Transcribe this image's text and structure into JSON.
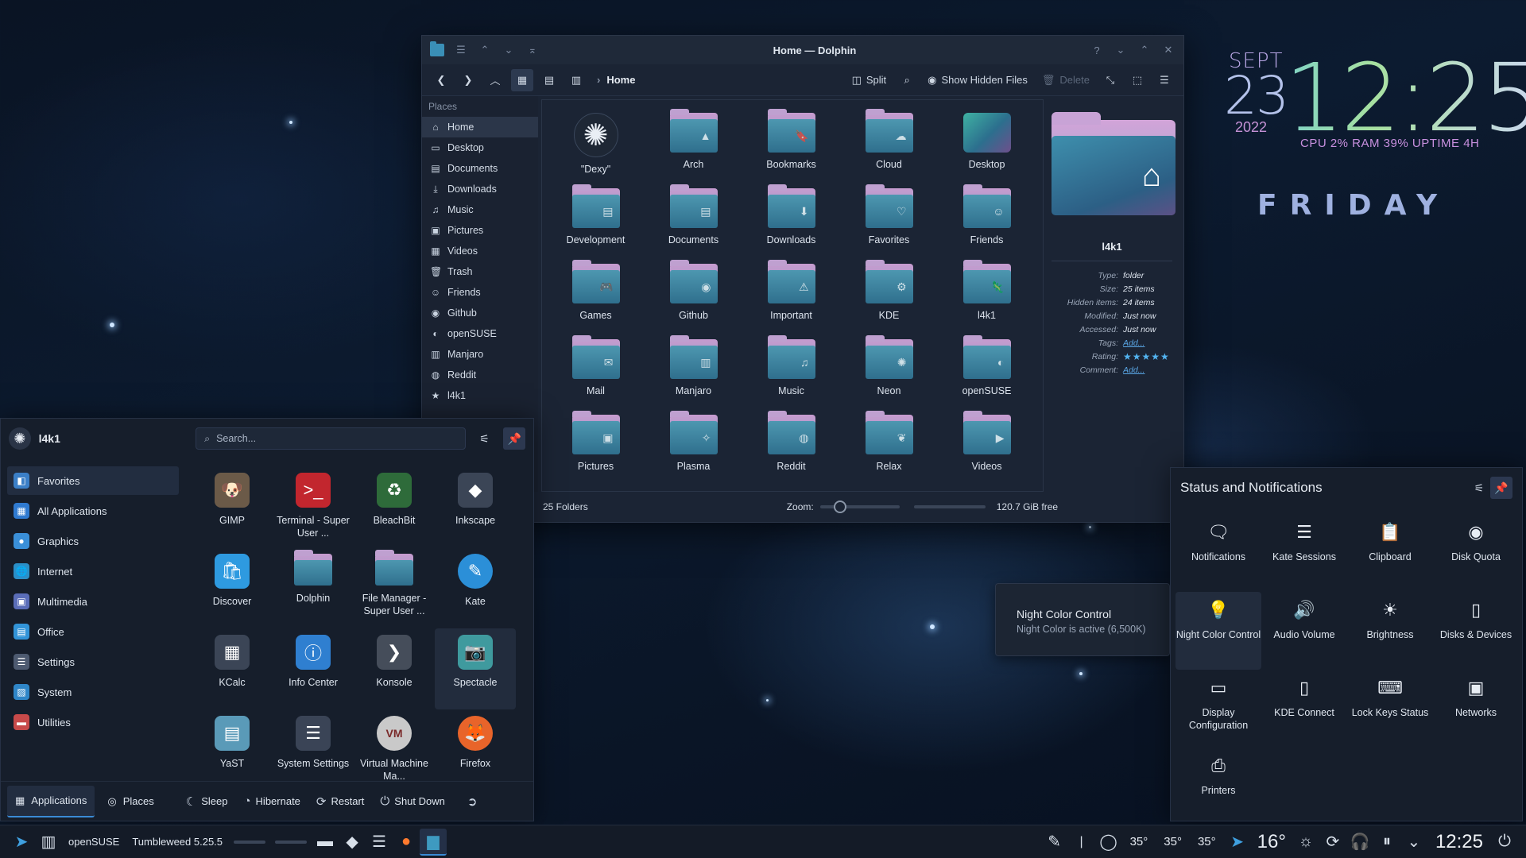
{
  "clock": {
    "month": "SEPT",
    "day": "23",
    "year": "2022",
    "time": "12:25",
    "stats": "CPU 2% RAM 39% UPTIME 4H",
    "weekday": "FRIDAY"
  },
  "dolphin": {
    "title": "Home — Dolphin",
    "breadcrumb": "Home",
    "toolbar": {
      "split": "Split",
      "show_hidden": "Show Hidden Files",
      "delete": "Delete"
    },
    "places_header": "Places",
    "places": [
      {
        "label": "Home",
        "icon": "home-icon",
        "glyph": "⌂",
        "selected": true
      },
      {
        "label": "Desktop",
        "icon": "desktop-icon",
        "glyph": "▭"
      },
      {
        "label": "Documents",
        "icon": "document-icon",
        "glyph": "▤"
      },
      {
        "label": "Downloads",
        "icon": "download-icon",
        "glyph": "⤓"
      },
      {
        "label": "Music",
        "icon": "music-icon",
        "glyph": "♫"
      },
      {
        "label": "Pictures",
        "icon": "picture-icon",
        "glyph": "▣"
      },
      {
        "label": "Videos",
        "icon": "video-icon",
        "glyph": "▦"
      },
      {
        "label": "Trash",
        "icon": "trash-icon",
        "glyph": "🗑"
      },
      {
        "label": "Friends",
        "icon": "friends-icon",
        "glyph": "☺"
      },
      {
        "label": "Github",
        "icon": "github-icon",
        "glyph": "◉"
      },
      {
        "label": "openSUSE",
        "icon": "opensuse-icon",
        "glyph": "◐"
      },
      {
        "label": "Manjaro",
        "icon": "manjaro-icon",
        "glyph": "▥"
      },
      {
        "label": "Reddit",
        "icon": "reddit-icon",
        "glyph": "◍"
      },
      {
        "label": "l4k1",
        "icon": "star-icon",
        "glyph": "★"
      }
    ],
    "folders": [
      {
        "label": "\"Dexy\"",
        "kind": "dexy",
        "glyph": "✺"
      },
      {
        "label": "Arch",
        "glyph": "▲"
      },
      {
        "label": "Bookmarks",
        "glyph": "🔖"
      },
      {
        "label": "Cloud",
        "glyph": "☁"
      },
      {
        "label": "Desktop",
        "kind": "desktop"
      },
      {
        "label": "Development",
        "glyph": "▤"
      },
      {
        "label": "Documents",
        "glyph": "▤"
      },
      {
        "label": "Downloads",
        "glyph": "⬇"
      },
      {
        "label": "Favorites",
        "glyph": "♡"
      },
      {
        "label": "Friends",
        "glyph": "☺"
      },
      {
        "label": "Games",
        "glyph": "🎮"
      },
      {
        "label": "Github",
        "glyph": "◉"
      },
      {
        "label": "Important",
        "glyph": "⚠"
      },
      {
        "label": "KDE",
        "glyph": "⚙"
      },
      {
        "label": "l4k1",
        "glyph": "🦎"
      },
      {
        "label": "Mail",
        "glyph": "✉"
      },
      {
        "label": "Manjaro",
        "glyph": "▥"
      },
      {
        "label": "Music",
        "glyph": "♫"
      },
      {
        "label": "Neon",
        "glyph": "✺"
      },
      {
        "label": "openSUSE",
        "glyph": "◐"
      },
      {
        "label": "Pictures",
        "glyph": "▣"
      },
      {
        "label": "Plasma",
        "glyph": "✧"
      },
      {
        "label": "Reddit",
        "glyph": "◍"
      },
      {
        "label": "Relax",
        "glyph": "❦"
      },
      {
        "label": "Videos",
        "glyph": "▶"
      }
    ],
    "info": {
      "name": "l4k1",
      "rows": [
        {
          "k": "Type:",
          "v": "folder"
        },
        {
          "k": "Size:",
          "v": "25 items"
        },
        {
          "k": "Hidden items:",
          "v": "24 items"
        },
        {
          "k": "Modified:",
          "v": "Just now"
        },
        {
          "k": "Accessed:",
          "v": "Just now"
        },
        {
          "k": "Tags:",
          "v": "Add...",
          "link": true
        },
        {
          "k": "Rating:",
          "v": "★★★★★",
          "stars": true
        },
        {
          "k": "Comment:",
          "v": "Add...",
          "link": true
        }
      ]
    },
    "status": {
      "count": "25 Folders",
      "zoom_label": "Zoom:",
      "free": "120.7 GiB free",
      "zoom_level": 0.2
    }
  },
  "launcher": {
    "user": "l4k1",
    "search_placeholder": "Search...",
    "categories": [
      {
        "label": "Favorites",
        "icon": "favorites-icon",
        "color": "#3b7fc7",
        "glyph": "◧",
        "selected": true
      },
      {
        "label": "All Applications",
        "icon": "all-apps-icon",
        "color": "#2f7ad0",
        "glyph": "▦"
      },
      {
        "label": "Graphics",
        "icon": "graphics-icon",
        "color": "#3a8fd8",
        "glyph": "●"
      },
      {
        "label": "Internet",
        "icon": "internet-icon",
        "color": "#2a8fc8",
        "glyph": "🌐"
      },
      {
        "label": "Multimedia",
        "icon": "multimedia-icon",
        "color": "#5a6db8",
        "glyph": "▣"
      },
      {
        "label": "Office",
        "icon": "office-icon",
        "color": "#3294d8",
        "glyph": "▤"
      },
      {
        "label": "Settings",
        "icon": "settings-icon",
        "color": "#4d5a70",
        "glyph": "☰"
      },
      {
        "label": "System",
        "icon": "system-icon",
        "color": "#2f86c8",
        "glyph": "▨"
      },
      {
        "label": "Utilities",
        "icon": "utilities-icon",
        "color": "#c74a4a",
        "glyph": "▬"
      }
    ],
    "apps": [
      {
        "label": "GIMP",
        "icon": "gimp-icon",
        "color": "#6b5a48",
        "glyph": "🐶"
      },
      {
        "label": "Terminal - Super User ...",
        "icon": "terminal-icon",
        "color": "#c2262e",
        "glyph": ">_"
      },
      {
        "label": "BleachBit",
        "icon": "bleachbit-icon",
        "color": "#2e6b3a",
        "glyph": "♻"
      },
      {
        "label": "Inkscape",
        "icon": "inkscape-icon",
        "color": "#3b4556",
        "glyph": "◆"
      },
      {
        "label": "Discover",
        "icon": "discover-icon",
        "color": "#2e9ae0",
        "glyph": "🛍"
      },
      {
        "label": "Dolphin",
        "icon": "dolphin-icon",
        "color": "#3e8aab",
        "glyph": ""
      },
      {
        "label": "File Manager - Super User ...",
        "icon": "file-manager-icon",
        "color": "#3e8aab",
        "glyph": ""
      },
      {
        "label": "Kate",
        "icon": "kate-icon",
        "color": "#2b8fd8",
        "glyph": "✎"
      },
      {
        "label": "KCalc",
        "icon": "kcalc-icon",
        "color": "#3b4556",
        "glyph": "▦"
      },
      {
        "label": "Info Center",
        "icon": "info-center-icon",
        "color": "#2f7fd0",
        "glyph": "ⓘ"
      },
      {
        "label": "Konsole",
        "icon": "konsole-icon",
        "color": "#454d5a",
        "glyph": "❯"
      },
      {
        "label": "Spectacle",
        "icon": "spectacle-icon",
        "color": "#3f9a9e",
        "glyph": "📷",
        "hover": true
      },
      {
        "label": "YaST",
        "icon": "yast-icon",
        "color": "#5a9ab8",
        "glyph": "▤"
      },
      {
        "label": "System Settings",
        "icon": "system-settings-icon",
        "color": "#3a4456",
        "glyph": "☰"
      },
      {
        "label": "Virtual Machine Ma...",
        "icon": "virt-manager-icon",
        "color": "#c9c9c9",
        "glyph": "VM"
      },
      {
        "label": "Firefox",
        "icon": "firefox-icon",
        "color": "#e8642a",
        "glyph": "🦊"
      }
    ],
    "footer": {
      "applications": "Applications",
      "places": "Places",
      "sleep": "Sleep",
      "hibernate": "Hibernate",
      "restart": "Restart",
      "shutdown": "Shut Down"
    }
  },
  "tray": {
    "title": "Status and Notifications",
    "items": [
      {
        "label": "Notifications",
        "icon": "notifications-icon",
        "glyph": "🗨"
      },
      {
        "label": "Kate Sessions",
        "icon": "kate-sessions-icon",
        "glyph": "☰"
      },
      {
        "label": "Clipboard",
        "icon": "clipboard-icon",
        "glyph": "📋"
      },
      {
        "label": "Disk Quota",
        "icon": "disk-quota-icon",
        "glyph": "◉"
      },
      {
        "label": "Night Color Control",
        "icon": "night-color-icon",
        "glyph": "💡",
        "hover": true
      },
      {
        "label": "Audio Volume",
        "icon": "audio-volume-icon",
        "glyph": "🔊"
      },
      {
        "label": "Brightness",
        "icon": "brightness-icon",
        "glyph": "☀"
      },
      {
        "label": "Disks & Devices",
        "icon": "disks-devices-icon",
        "glyph": "▯"
      },
      {
        "label": "Display Configuration",
        "icon": "display-config-icon",
        "glyph": "▭"
      },
      {
        "label": "KDE Connect",
        "icon": "kde-connect-icon",
        "glyph": "▯"
      },
      {
        "label": "Lock Keys Status",
        "icon": "lock-keys-icon",
        "glyph": "⌨"
      },
      {
        "label": "Networks",
        "icon": "networks-icon",
        "glyph": "▣"
      },
      {
        "label": "Printers",
        "icon": "printers-icon",
        "glyph": "⎙"
      }
    ],
    "tooltip": {
      "title": "Night Color Control",
      "subtitle": "Night Color is active (6,500K)"
    }
  },
  "panel": {
    "distro": "openSUSE",
    "version": "Tumbleweed 5.25.5",
    "temps": [
      "35°",
      "35°",
      "35°"
    ],
    "weather_temp": "16°",
    "time": "12:25"
  }
}
